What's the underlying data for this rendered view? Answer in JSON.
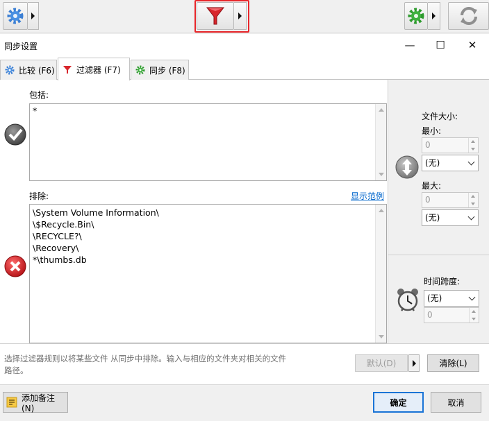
{
  "dialog": {
    "title": "同步设置",
    "window_controls": {
      "minimize": "—",
      "maximize": "☐",
      "close": "✕"
    }
  },
  "tabs": [
    {
      "label": "比较 (F6)",
      "icon": "gear-blue-icon"
    },
    {
      "label": "过滤器 (F7)",
      "icon": "funnel-red-icon",
      "active": true
    },
    {
      "label": "同步 (F8)",
      "icon": "gear-green-icon"
    }
  ],
  "include": {
    "label": "包括:",
    "lines": [
      "*"
    ]
  },
  "exclude": {
    "label": "排除:",
    "show_example": "显示范例",
    "lines": [
      "\\System Volume Information\\",
      "\\$Recycle.Bin\\",
      "\\RECYCLE?\\",
      "\\Recovery\\",
      "*\\thumbs.db"
    ]
  },
  "file_size": {
    "label": "文件大小:",
    "min_label": "最小:",
    "min_value": "0",
    "min_unit": "(无)",
    "max_label": "最大:",
    "max_value": "0",
    "max_unit": "(无)"
  },
  "time_span": {
    "label": "时间跨度:",
    "unit": "(无)",
    "value": "0"
  },
  "hint": "选择过滤器规则以将某些文件 从同步中排除。输入与相应的文件夹对相关的文件路径。",
  "buttons": {
    "default": "默认(D)",
    "clear": "清除(L)",
    "add_note": "添加备注(N)",
    "ok": "确定",
    "cancel": "取消"
  },
  "colors": {
    "highlight": "#e8262a",
    "accent": "#1a74d6",
    "link": "#0066cc"
  }
}
